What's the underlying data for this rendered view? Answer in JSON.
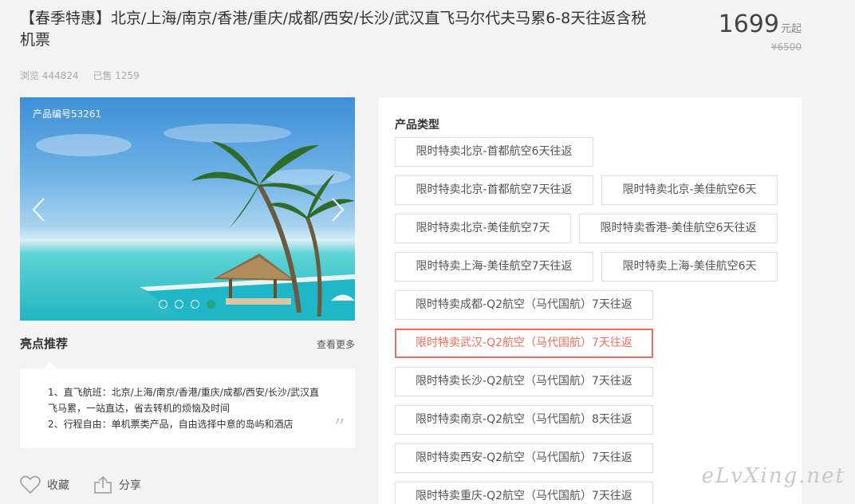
{
  "product": {
    "title": "【春季特惠】北京/上海/南京/香港/重庆/成都/西安/长沙/武汉直飞马尔代夫马累6-8天往返含税机票",
    "price": "1699",
    "price_unit": "元起",
    "original_price": "¥6500",
    "views": "浏览 444824",
    "sold": "已售 1259"
  },
  "carousel": {
    "product_number": "产品编号53261",
    "slide_count": 4,
    "active_index": 3
  },
  "highlights": {
    "title": "亮点推荐",
    "more": "查看更多",
    "line1": "1、直飞航班：北京/上海/南京/香港/重庆/成都/西安/长沙/武汉直飞马累，一站直达，省去转机的烦恼及时间",
    "line2": "2、行程自由：单机票类产品，自由选择中意的岛屿和酒店"
  },
  "actions": {
    "favorite": "收藏",
    "share": "分享"
  },
  "product_types": {
    "title": "产品类型",
    "options": [
      "限时特卖北京-首都航空6天往返",
      "限时特卖北京-首都航空7天往返",
      "限时特卖北京-美佳航空6天",
      "限时特卖北京-美佳航空7天",
      "限时特卖香港-美佳航空6天往返",
      "限时特卖上海-美佳航空7天往返",
      "限时特卖上海-美佳航空6天",
      "限时特卖成都-Q2航空（马代国航）7天往返",
      "限时特卖武汉-Q2航空（马代国航）7天往返",
      "限时特卖长沙-Q2航空（马代国航）7天往返",
      "限时特卖南京-Q2航空（马代国航）8天往返",
      "限时特卖西安-Q2航空（马代国航）7天往返",
      "限时特卖重庆-Q2航空（马代国航）7天往返"
    ],
    "selected": "限时特卖武汉-Q2航空（马代国航）7天往返"
  },
  "watermark": "eLvXing.net",
  "colors": {
    "accent": "#f06c5c",
    "active_dot": "#26a67b"
  }
}
